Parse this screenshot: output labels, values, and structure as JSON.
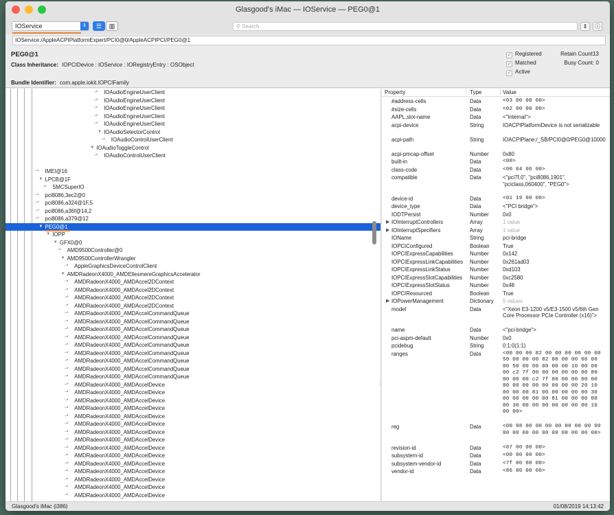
{
  "window": {
    "title": "Glasgood's iMac — IOService — PEG0@1",
    "plane_selector": "IOService",
    "search_placeholder": "Search",
    "path": "IOService:/AppleACPIPlatformExpert/PCI0@0/AppleACPIPCI/PEG0@1",
    "colors": {
      "accent": "#1a63da",
      "orange": "#e8843a",
      "close": "#fe5f57",
      "min": "#febb2e",
      "max": "#29c840"
    }
  },
  "header": {
    "name": "PEG0@1",
    "class_label": "Class Inheritance:",
    "class_value": "IOPCIDevice : IOService : IORegistryEntry : OSObject",
    "bundle_label": "Bundle Identifier:",
    "bundle_value": "com.apple.iokit.IOPCIFamily",
    "checks": [
      {
        "label": "Registered",
        "checked": true
      },
      {
        "label": "Matched",
        "checked": true
      },
      {
        "label": "Active",
        "checked": true
      }
    ],
    "retain_label": "Retain Count:",
    "retain_value": "13",
    "busy_label": "Busy Count:",
    "busy_value": "0"
  },
  "tree": [
    {
      "label": "IOAudioEngineUserClient",
      "depth": 13,
      "kind": "leaf"
    },
    {
      "label": "IOAudioEngineUserClient",
      "depth": 13,
      "kind": "leaf"
    },
    {
      "label": "IOAudioEngineUserClient",
      "depth": 13,
      "kind": "leaf"
    },
    {
      "label": "IOAudioEngineUserClient",
      "depth": 13,
      "kind": "leaf"
    },
    {
      "label": "IOAudioEngineUserClient",
      "depth": 13,
      "kind": "leaf"
    },
    {
      "label": "IOAudioSelectorControl",
      "depth": 13,
      "kind": "open"
    },
    {
      "label": "IOAudioControlUserClient",
      "depth": 14,
      "kind": "leaf"
    },
    {
      "label": "IOAudioToggleControl",
      "depth": 12,
      "kind": "open"
    },
    {
      "label": "IOAudioControlUserClient",
      "depth": 13,
      "kind": "leaf"
    },
    {
      "label": "",
      "depth": 0,
      "kind": "blank"
    },
    {
      "label": "IMEI@16",
      "depth": 5,
      "kind": "leaf"
    },
    {
      "label": "LPCB@1F",
      "depth": 5,
      "kind": "open"
    },
    {
      "label": "SMCSuperIO",
      "depth": 6,
      "kind": "leaf"
    },
    {
      "label": "pci8086,3ec2@0",
      "depth": 5,
      "kind": "leaf"
    },
    {
      "label": "pci8086,a324@1F,5",
      "depth": 5,
      "kind": "leaf"
    },
    {
      "label": "pci8086,a36f@14,2",
      "depth": 5,
      "kind": "leaf"
    },
    {
      "label": "pci8086,a379@12",
      "depth": 5,
      "kind": "leaf"
    },
    {
      "label": "PEG0@1",
      "depth": 5,
      "kind": "open",
      "selected": true
    },
    {
      "label": "IOPP",
      "depth": 6,
      "kind": "open"
    },
    {
      "label": "GFX0@0",
      "depth": 7,
      "kind": "open"
    },
    {
      "label": "AMD9500Controller@0",
      "depth": 8,
      "kind": "leaf"
    },
    {
      "label": "AMD9500ControllerWrangler",
      "depth": 8,
      "kind": "open"
    },
    {
      "label": "AppleGraphicsDeviceControlClient",
      "depth": 9,
      "kind": "leaf"
    },
    {
      "label": "AMDRadeonX4000_AMDEllesmereGraphicsAccelerator",
      "depth": 8,
      "kind": "open"
    },
    {
      "label": "AMDRadeonX4000_AMDAccel2DContext",
      "depth": 9,
      "kind": "leaf"
    },
    {
      "label": "AMDRadeonX4000_AMDAccel2DContext",
      "depth": 9,
      "kind": "leaf"
    },
    {
      "label": "AMDRadeonX4000_AMDAccel2DContext",
      "depth": 9,
      "kind": "leaf"
    },
    {
      "label": "AMDRadeonX4000_AMDAccel2DContext",
      "depth": 9,
      "kind": "leaf"
    },
    {
      "label": "AMDRadeonX4000_AMDAccelCommandQueue",
      "depth": 9,
      "kind": "leaf"
    },
    {
      "label": "AMDRadeonX4000_AMDAccelCommandQueue",
      "depth": 9,
      "kind": "leaf"
    },
    {
      "label": "AMDRadeonX4000_AMDAccelCommandQueue",
      "depth": 9,
      "kind": "leaf"
    },
    {
      "label": "AMDRadeonX4000_AMDAccelCommandQueue",
      "depth": 9,
      "kind": "leaf"
    },
    {
      "label": "AMDRadeonX4000_AMDAccelCommandQueue",
      "depth": 9,
      "kind": "leaf"
    },
    {
      "label": "AMDRadeonX4000_AMDAccelCommandQueue",
      "depth": 9,
      "kind": "leaf"
    },
    {
      "label": "AMDRadeonX4000_AMDAccelCommandQueue",
      "depth": 9,
      "kind": "leaf"
    },
    {
      "label": "AMDRadeonX4000_AMDAccelCommandQueue",
      "depth": 9,
      "kind": "leaf"
    },
    {
      "label": "AMDRadeonX4000_AMDAccelCommandQueue",
      "depth": 9,
      "kind": "leaf"
    },
    {
      "label": "AMDRadeonX4000_AMDAccelDevice",
      "depth": 9,
      "kind": "leaf"
    },
    {
      "label": "AMDRadeonX4000_AMDAccelDevice",
      "depth": 9,
      "kind": "leaf"
    },
    {
      "label": "AMDRadeonX4000_AMDAccelDevice",
      "depth": 9,
      "kind": "leaf"
    },
    {
      "label": "AMDRadeonX4000_AMDAccelDevice",
      "depth": 9,
      "kind": "leaf"
    },
    {
      "label": "AMDRadeonX4000_AMDAccelDevice",
      "depth": 9,
      "kind": "leaf"
    },
    {
      "label": "AMDRadeonX4000_AMDAccelDevice",
      "depth": 9,
      "kind": "leaf"
    },
    {
      "label": "AMDRadeonX4000_AMDAccelDevice",
      "depth": 9,
      "kind": "leaf"
    },
    {
      "label": "AMDRadeonX4000_AMDAccelDevice",
      "depth": 9,
      "kind": "leaf"
    },
    {
      "label": "AMDRadeonX4000_AMDAccelDevice",
      "depth": 9,
      "kind": "leaf"
    },
    {
      "label": "AMDRadeonX4000_AMDAccelDevice",
      "depth": 9,
      "kind": "leaf"
    },
    {
      "label": "AMDRadeonX4000_AMDAccelDevice",
      "depth": 9,
      "kind": "leaf"
    },
    {
      "label": "AMDRadeonX4000_AMDAccelDevice",
      "depth": 9,
      "kind": "leaf"
    },
    {
      "label": "AMDRadeonX4000_AMDAccelDevice",
      "depth": 9,
      "kind": "leaf"
    },
    {
      "label": "AMDRadeonX4000_AMDAccelDevice",
      "depth": 9,
      "kind": "leaf"
    },
    {
      "label": "AMDRadeonX4000_AMDAccelDevice",
      "depth": 9,
      "kind": "leaf"
    }
  ],
  "properties": {
    "columns": [
      "Property",
      "Type",
      "Value"
    ],
    "rows": [
      {
        "key": "#address-cells",
        "type": "Data",
        "value": "<03 00 00 00>",
        "mono": true,
        "lines": 1
      },
      {
        "key": "#size-cells",
        "type": "Data",
        "value": "<02 00 00 00>",
        "mono": true,
        "lines": 1
      },
      {
        "key": "AAPL,slot-name",
        "type": "Data",
        "value": "<\"Internal\">",
        "lines": 1
      },
      {
        "key": "acpi-device",
        "type": "String",
        "value": "IOACPIPlatformDevice is not serializable",
        "lines": 2
      },
      {
        "key": "acpi-path",
        "type": "String",
        "value": "IOACPIPlane:/_SB/PCI0@0/PEG0@10000",
        "lines": 2
      },
      {
        "key": "acpi-pmcap-offset",
        "type": "Number",
        "value": "0x80",
        "lines": 1
      },
      {
        "key": "built-in",
        "type": "Data",
        "value": "<00>",
        "mono": true,
        "lines": 1
      },
      {
        "key": "class-code",
        "type": "Data",
        "value": "<00 04 06 00>",
        "mono": true,
        "lines": 1
      },
      {
        "key": "compatible",
        "type": "Data",
        "value": "<\"pci7f,0\", \"pci8086,1901\", \"pciclass,060400\", \"PEG0\">",
        "lines": 3
      },
      {
        "key": "device-id",
        "type": "Data",
        "value": "<01 19 00 00>",
        "mono": true,
        "lines": 1
      },
      {
        "key": "device_type",
        "type": "Data",
        "value": "<\"PCI bridge\">",
        "lines": 1
      },
      {
        "key": "IODTPersist",
        "type": "Number",
        "value": "0x0",
        "lines": 1
      },
      {
        "key": "IOInterruptControllers",
        "type": "Array",
        "value": "1 value",
        "dim": true,
        "expand": true,
        "lines": 1
      },
      {
        "key": "IOInterruptSpecifiers",
        "type": "Array",
        "value": "1 value",
        "dim": true,
        "expand": true,
        "lines": 1
      },
      {
        "key": "IOName",
        "type": "String",
        "value": "pci-bridge",
        "lines": 1
      },
      {
        "key": "IOPCIConfigured",
        "type": "Boolean",
        "value": "True",
        "lines": 1
      },
      {
        "key": "IOPCIExpressCapabilities",
        "type": "Number",
        "value": "0x142",
        "lines": 1
      },
      {
        "key": "IOPCIExpressLinkCapabilities",
        "type": "Number",
        "value": "0x261ad03",
        "lines": 1
      },
      {
        "key": "IOPCIExpressLinkStatus",
        "type": "Number",
        "value": "0xd103",
        "lines": 1
      },
      {
        "key": "IOPCIExpressSlotCapabilities",
        "type": "Number",
        "value": "0xc2580",
        "lines": 1
      },
      {
        "key": "IOPCIExpressSlotStatus",
        "type": "Number",
        "value": "0x48",
        "lines": 1
      },
      {
        "key": "IOPCIResourced",
        "type": "Boolean",
        "value": "True",
        "lines": 1
      },
      {
        "key": "IOPowerManagement",
        "type": "Dictionary",
        "value": "5 values",
        "dim": true,
        "expand": true,
        "lines": 1
      },
      {
        "key": "model",
        "type": "Data",
        "value": "<\"Xeon E3-1200 v5/E3-1500 v5/6th Gen Core Processor PCIe Controller (x16)\">",
        "lines": 3
      },
      {
        "key": "name",
        "type": "Data",
        "value": "<\"pci-bridge\">",
        "lines": 1
      },
      {
        "key": "pci-aspm-default",
        "type": "Number",
        "value": "0x0",
        "lines": 1
      },
      {
        "key": "pcidebug",
        "type": "String",
        "value": "0:1:0(1:1)",
        "lines": 1
      },
      {
        "key": "ranges",
        "type": "Data",
        "value": "<00 00 00 82 00 00 00 00 00 00 50 00 00 00 82 00 00 00 00 00 00 50 00 00 00 00 00 10 00 00 00 c2 7f 00 00 00 00 00 00 80 00 00 00 c2 7f 00 00 00 00 00 80 00 00 00 00 00 00 00 20 10 00 00 00 81 00 00 00 00 00 30 00 00 00 00 00 81 00 00 00 00 00 30 00 00 00 00 00 00 00 10 00 00>",
        "mono": true,
        "lines": 11
      },
      {
        "key": "reg",
        "type": "Data",
        "value": "<00 08 00 00 00 00 00 00 00 00 00 00 00 00 00 00 00 00 00 00>",
        "mono": true,
        "lines": 3
      },
      {
        "key": "revision-id",
        "type": "Data",
        "value": "<07 00 00 00>",
        "mono": true,
        "lines": 1
      },
      {
        "key": "subsystem-id",
        "type": "Data",
        "value": "<00 00 00 00>",
        "mono": true,
        "lines": 1
      },
      {
        "key": "subsystem-vendor-id",
        "type": "Data",
        "value": "<7f 00 00 00>",
        "mono": true,
        "lines": 1
      },
      {
        "key": "vendor-id",
        "type": "Data",
        "value": "<86 80 00 00>",
        "mono": true,
        "lines": 1
      }
    ]
  },
  "status": {
    "left": "Glasgood's iMac (i386)",
    "right": "01/08/2019 14:13:42"
  }
}
